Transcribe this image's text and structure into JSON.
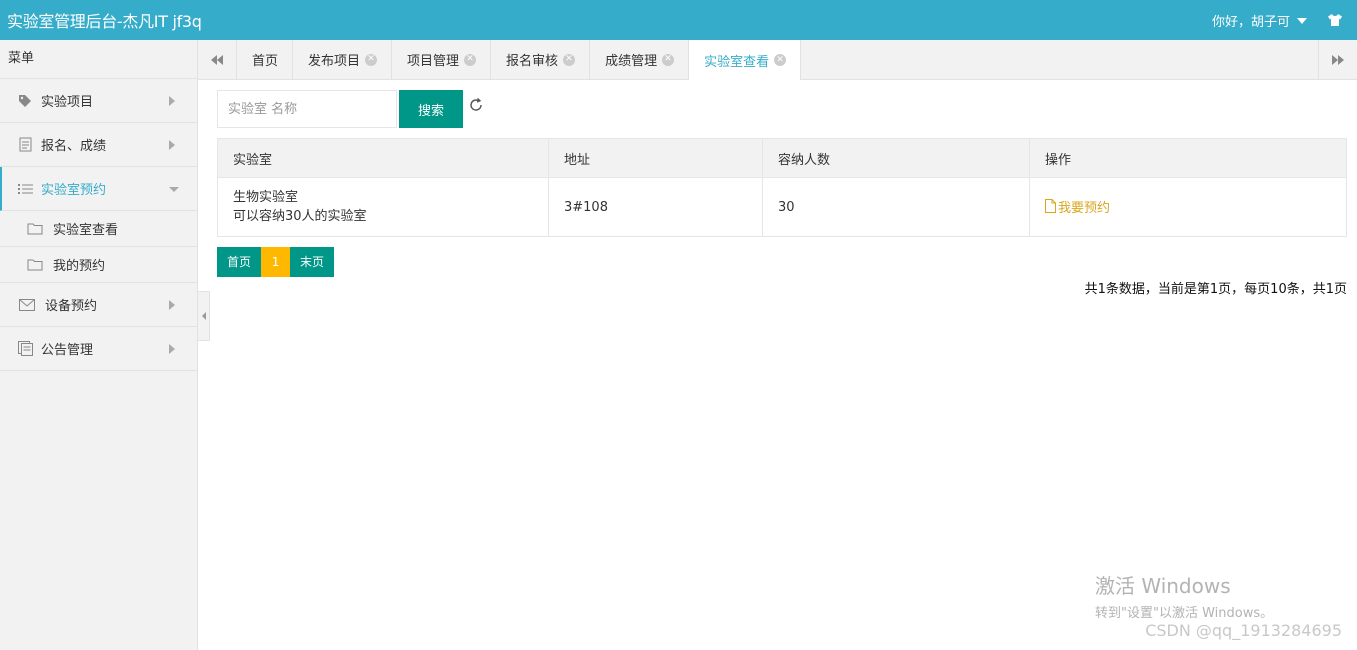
{
  "header": {
    "title": "实验室管理后台-杰凡IT jf3q",
    "greeting": "你好，胡子可"
  },
  "sidebar": {
    "menu_title": "菜单",
    "items": [
      {
        "label": "实验项目",
        "icon": "tag-icon"
      },
      {
        "label": "报名、成绩",
        "icon": "document-icon"
      },
      {
        "label": "实验室预约",
        "icon": "list-icon",
        "expanded": true
      },
      {
        "label": "设备预约",
        "icon": "mail-icon"
      },
      {
        "label": "公告管理",
        "icon": "notice-icon"
      }
    ],
    "sub_items": [
      {
        "label": "实验室查看",
        "icon": "folder-icon"
      },
      {
        "label": "我的预约",
        "icon": "folder-icon"
      }
    ]
  },
  "tabs": [
    {
      "label": "首页",
      "closable": false
    },
    {
      "label": "发布项目",
      "closable": true
    },
    {
      "label": "项目管理",
      "closable": true
    },
    {
      "label": "报名审核",
      "closable": true
    },
    {
      "label": "成绩管理",
      "closable": true
    },
    {
      "label": "实验室查看",
      "closable": true,
      "active": true
    }
  ],
  "search": {
    "placeholder": "实验室 名称",
    "button_label": "搜索"
  },
  "table": {
    "headers": [
      "实验室",
      "地址",
      "容纳人数",
      "操作"
    ],
    "rows": [
      {
        "name": "生物实验室",
        "desc": "可以容纳30人的实验室",
        "address": "3#108",
        "capacity": "30",
        "action": "我要预约"
      }
    ]
  },
  "pager": {
    "first": "首页",
    "current": "1",
    "last": "末页",
    "summary": "共1条数据，当前是第1页，每页10条，共1页"
  },
  "watermark": {
    "title": "激活 Windows",
    "subtitle": "转到\"设置\"以激活 Windows。",
    "csdn": "CSDN @qq_1913284695"
  },
  "colors": {
    "header": "#35acc9",
    "primary_button": "#009688",
    "current_page": "#ffb800",
    "link": "#d9a61e"
  }
}
